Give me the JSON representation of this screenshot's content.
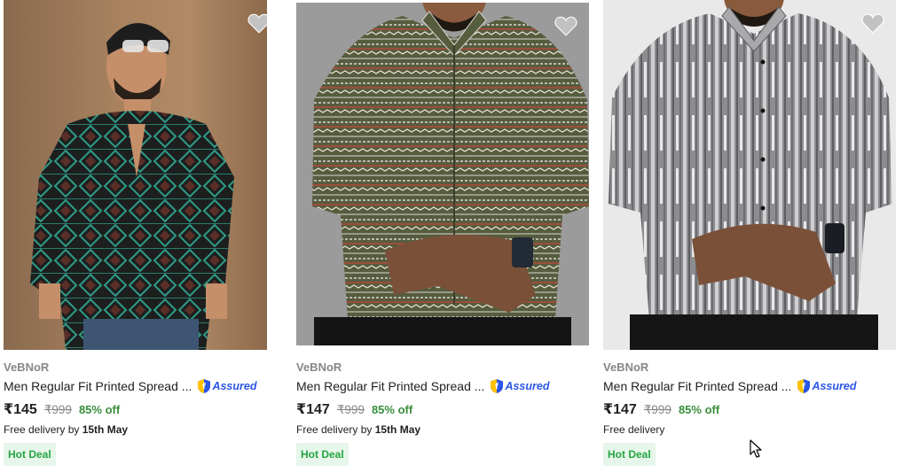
{
  "colors": {
    "brand_gray": "#878787",
    "text_dark": "#212121",
    "discount_green": "#388e3c",
    "deal_bg": "#e6f6ea",
    "deal_text": "#26a541",
    "assured_blue": "#2a55e5",
    "heart_gray": "#c2c2c2"
  },
  "products": [
    {
      "brand": "VeBNoR",
      "title": "Men Regular Fit Printed Spread ...",
      "assured_label": "Assured",
      "price": "₹145",
      "mrp": "₹999",
      "discount": "85% off",
      "delivery_prefix": "Free delivery",
      "delivery_suffix": " by ",
      "delivery_date": "15th May",
      "deal_badge": "Hot Deal",
      "wishlist_icon": "heart-icon"
    },
    {
      "brand": "VeBNoR",
      "title": "Men Regular Fit Printed Spread ...",
      "assured_label": "Assured",
      "price": "₹147",
      "mrp": "₹999",
      "discount": "85% off",
      "delivery_prefix": "Free delivery",
      "delivery_suffix": " by ",
      "delivery_date": "15th May",
      "deal_badge": "Hot Deal",
      "wishlist_icon": "heart-icon"
    },
    {
      "brand": "VeBNoR",
      "title": "Men Regular Fit Printed Spread ...",
      "assured_label": "Assured",
      "price": "₹147",
      "mrp": "₹999",
      "discount": "85% off",
      "delivery_prefix": "Free delivery",
      "delivery_suffix": "",
      "delivery_date": "",
      "deal_badge": "Hot Deal",
      "wishlist_icon": "heart-icon"
    }
  ]
}
